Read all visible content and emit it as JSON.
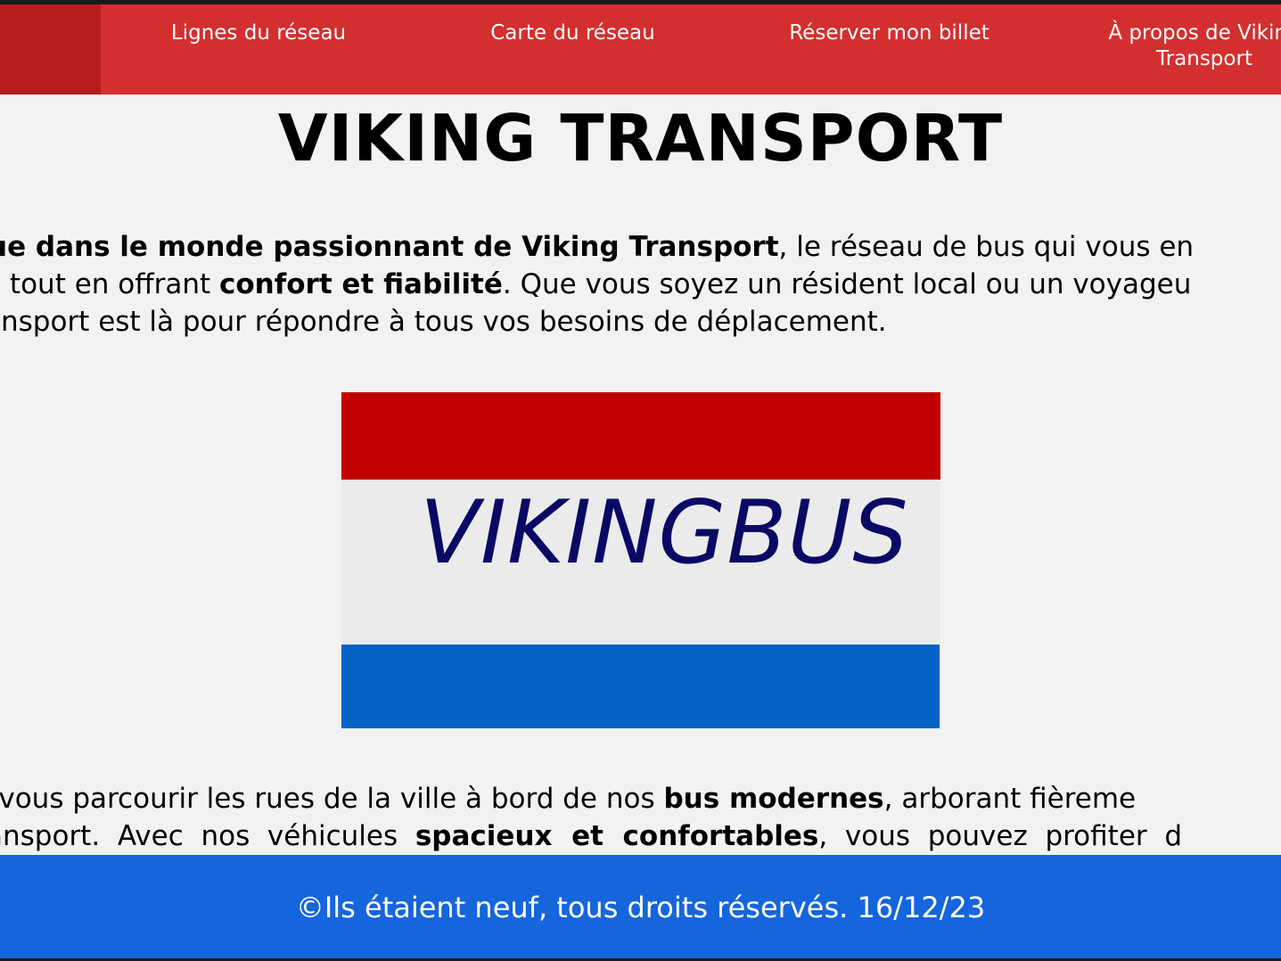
{
  "nav": {
    "items": [
      {
        "label": "Lignes du réseau"
      },
      {
        "label": "Carte du réseau"
      },
      {
        "label": "Réserver mon billet"
      },
      {
        "label": "À propos de Viking Transport"
      }
    ]
  },
  "main": {
    "title": "VIKING TRANSPORT",
    "intro": {
      "line1_part1": "ue dans le monde passionnant de Viking Transport",
      "line1_part2": ", le réseau de bus qui vous en",
      "line2_part1": "e tout en offrant ",
      "line2_bold": "confort et fiabilité",
      "line2_part2": ". Que vous soyez un résident local ou un voyageu",
      "line3": "ansport est là pour répondre à tous vos besoins de déplacement."
    },
    "logo": {
      "text": "VIKINGBUS",
      "colors": {
        "top": "#c00000",
        "middle": "#ebebeb",
        "bottom": "#0563c6",
        "text": "#0a0a66"
      }
    },
    "second": {
      "line1_part1": "-vous parcourir les rues de la ville à bord de nos ",
      "line1_bold": "bus modernes",
      "line1_part2": ", arborant fièreme",
      "line2_part1": "ansport.  Avec  nos  véhicules  ",
      "line2_bold": "spacieux  et  confortables",
      "line2_part2": ",  vous  pouvez  profiter  d"
    }
  },
  "footer": {
    "text": "©Ils étaient neuf, tous droits réservés. 16/12/23"
  },
  "colors": {
    "nav_bg": "#d32f2f",
    "nav_home_bg": "#b71c1c",
    "footer_bg": "#1565dd",
    "page_bg": "#f2f2f2"
  }
}
